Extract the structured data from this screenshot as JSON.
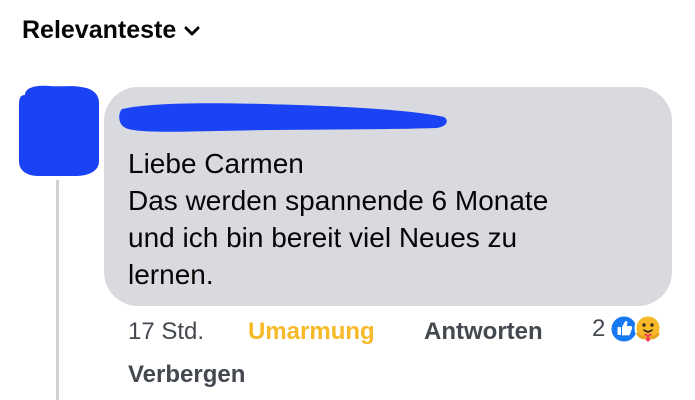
{
  "sort": {
    "label": "Relevanteste",
    "icon": "chevron-down-icon"
  },
  "comment": {
    "avatar": {
      "redacted": true,
      "redaction_color": "#1a43f5"
    },
    "author": {
      "redacted": true,
      "redaction_color": "#1a43f5"
    },
    "text": "Liebe Carmen\nDas werden spannende 6 Monate\nund ich bin bereit viel Neues zu\nlernen.",
    "bubble_color": "#d9dadf"
  },
  "actions": {
    "time": "17 Std.",
    "reaction_label": "Umarmung",
    "reaction_color": "#f7b928",
    "reply_label": "Antworten",
    "hide_label": "Verbergen"
  },
  "reactions": {
    "count": "2",
    "icons": [
      "like-icon",
      "care-icon"
    ]
  }
}
